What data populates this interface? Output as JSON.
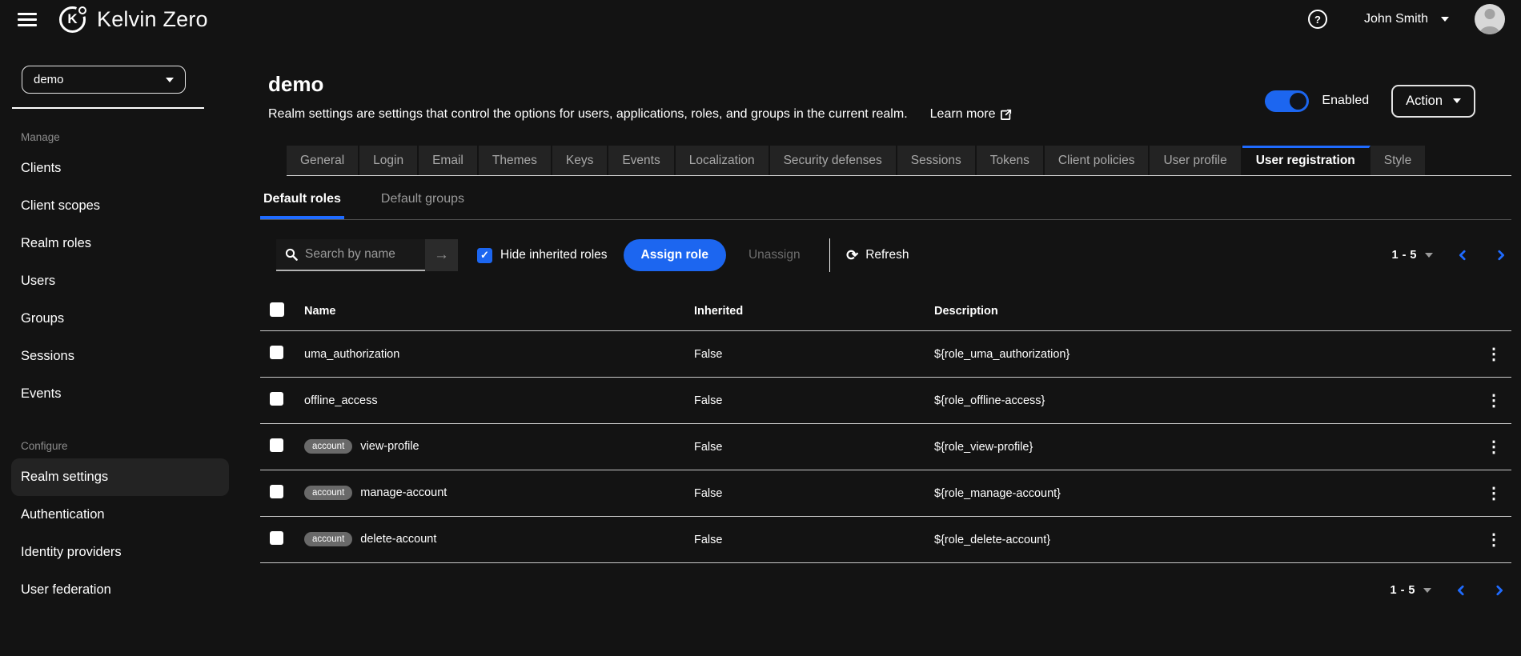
{
  "topbar": {
    "brand": "Kelvin Zero",
    "user_name": "John Smith"
  },
  "icons": {
    "help": "?",
    "arrow_right": "→",
    "refresh": "⟳",
    "check": "✓",
    "kebab": "⋮"
  },
  "sidebar": {
    "realm": "demo",
    "sections": [
      {
        "label": "Manage",
        "items": [
          "Clients",
          "Client scopes",
          "Realm roles",
          "Users",
          "Groups",
          "Sessions",
          "Events"
        ]
      },
      {
        "label": "Configure",
        "items": [
          "Realm settings",
          "Authentication",
          "Identity providers",
          "User federation"
        ]
      }
    ],
    "active_item": "Realm settings"
  },
  "page": {
    "title": "demo",
    "description": "Realm settings are settings that control the options for users, applications, roles, and groups in the current realm.",
    "learn_more_label": "Learn more",
    "enabled_label": "Enabled",
    "action_label": "Action"
  },
  "tabs": {
    "items": [
      {
        "label": "General"
      },
      {
        "label": "Login"
      },
      {
        "label": "Email"
      },
      {
        "label": "Themes"
      },
      {
        "label": "Keys"
      },
      {
        "label": "Events"
      },
      {
        "label": "Localization"
      },
      {
        "label": "Security defenses"
      },
      {
        "label": "Sessions"
      },
      {
        "label": "Tokens"
      },
      {
        "label": "Client policies"
      },
      {
        "label": "User profile"
      },
      {
        "label": "User registration",
        "active": true
      },
      {
        "label": "Style"
      }
    ]
  },
  "subtabs": {
    "items": [
      {
        "label": "Default roles",
        "active": true
      },
      {
        "label": "Default groups",
        "active": false
      }
    ]
  },
  "toolbar": {
    "search_placeholder": "Search by name",
    "hide_inherited_label": "Hide inherited roles",
    "hide_inherited_checked": true,
    "assign_role_label": "Assign role",
    "unassign_label": "Unassign",
    "refresh_label": "Refresh"
  },
  "pagination": {
    "range": "1 - 5"
  },
  "table": {
    "headers": [
      "Name",
      "Inherited",
      "Description"
    ],
    "rows": [
      {
        "name": "uma_authorization",
        "inherited": "False",
        "description": "${role_uma_authorization}"
      },
      {
        "name": "offline_access",
        "inherited": "False",
        "description": "${role_offline-access}"
      },
      {
        "badge": "account",
        "name": "view-profile",
        "inherited": "False",
        "description": "${role_view-profile}"
      },
      {
        "badge": "account",
        "name": "manage-account",
        "inherited": "False",
        "description": "${role_manage-account}"
      },
      {
        "badge": "account",
        "name": "delete-account",
        "inherited": "False",
        "description": "${role_delete-account}"
      }
    ]
  },
  "colors": {
    "accent": "#1c66f0",
    "badge_bg": "#696969"
  }
}
